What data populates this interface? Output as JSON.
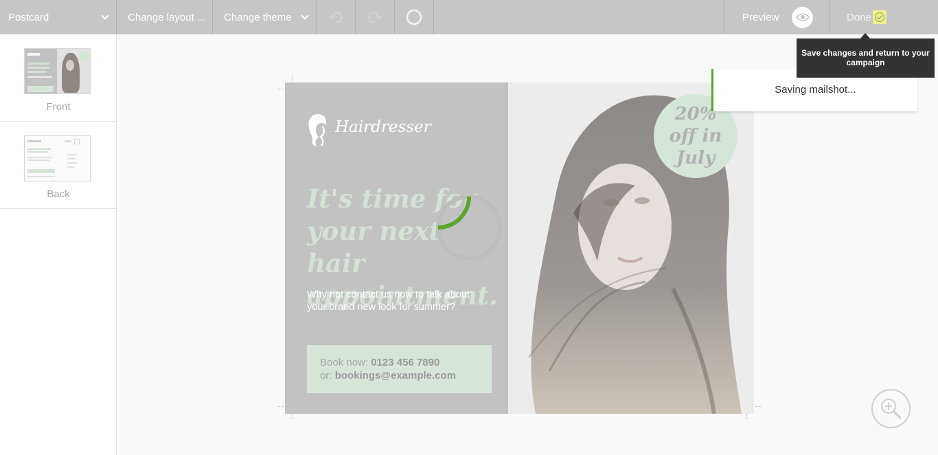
{
  "toolbar": {
    "format_select": "Postcard",
    "change_layout": "Change layout ...",
    "change_theme": "Change theme",
    "preview": "Preview",
    "done": "Done"
  },
  "sidebar": {
    "pages": [
      {
        "label": "Front"
      },
      {
        "label": "Back"
      }
    ]
  },
  "postcard": {
    "brand": "Hairdresser",
    "headline_lines": [
      "It's time for",
      "your next hair",
      "appointment."
    ],
    "subline_lines": [
      "Why not contact us now to talk about",
      "your brand new look for summer?"
    ],
    "booking": {
      "phone_prefix": "Book now:",
      "phone": "0123 456 7890",
      "email_prefix": "or:",
      "email": "bookings@example.com"
    },
    "badge_lines": [
      "20%",
      "off in",
      "July"
    ]
  },
  "status": {
    "saving_message": "Saving mailshot...",
    "progress": 0.25
  },
  "tooltip": {
    "text": "Save changes and return to your campaign"
  },
  "colors": {
    "toolbar_bg": "#c6c6c6",
    "accent_green": "#5da52e",
    "panel_bg": "#c2c2c2",
    "mint": "#d7e5d9",
    "done_highlight": "#f4ef8c"
  },
  "icons": {
    "format": "chevron-down-icon",
    "theme": "chevron-down-icon",
    "undo": "undo-icon",
    "redo": "redo-icon",
    "status": "progress-ring-icon",
    "preview": "eye-icon",
    "done": "check-icon",
    "zoom": "zoom-in-icon",
    "brand": "woman-silhouette-icon"
  }
}
